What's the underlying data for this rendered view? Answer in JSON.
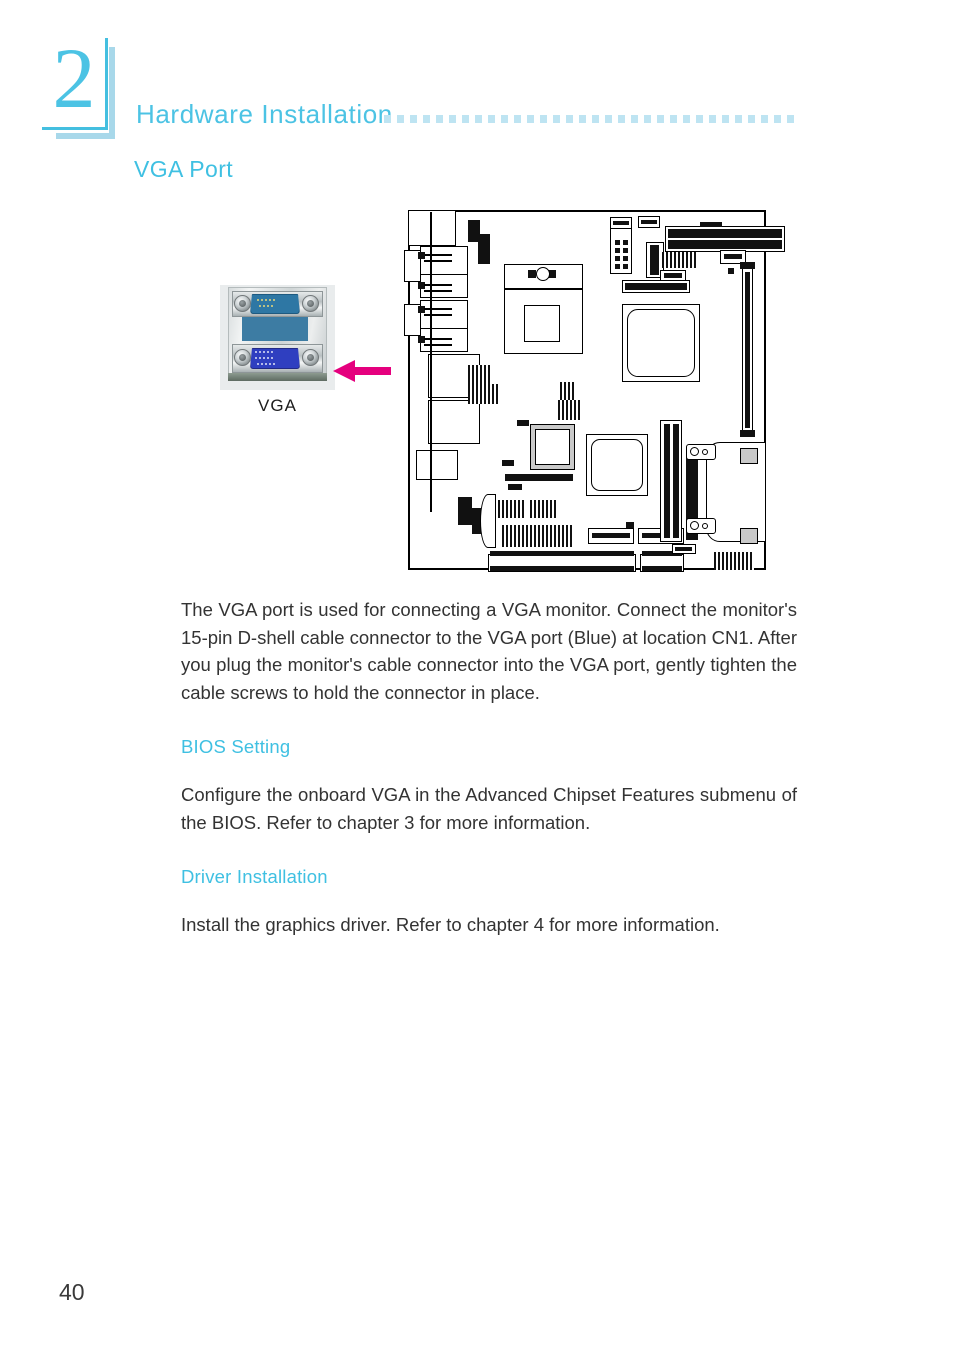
{
  "page": {
    "number": "40",
    "chapter_number": "2",
    "chapter_title": "Hardware Installation",
    "accent_color": "#3fc0e2",
    "accent_light_color": "#bee4f2",
    "arrow_color": "#e5007e",
    "body_color": "#333333"
  },
  "section": {
    "heading": "VGA Port"
  },
  "figure": {
    "photo_caption": "VGA",
    "arrow_icon": "left-arrow-icon",
    "photo_alt": "VGA port connector photo",
    "board_alt": "motherboard layout diagram"
  },
  "paragraphs": {
    "intro": "The VGA port is used for connecting a VGA monitor. Connect the monitor's 15-pin D-shell cable connector to the VGA port (Blue) at location CN1. After you plug the monitor's cable connector into the VGA port, gently tighten the cable screws to hold the connector in place."
  },
  "subsections": [
    {
      "heading": "BIOS Setting",
      "body": "Configure the onboard VGA in the Advanced Chipset Features submenu of the BIOS. Refer to chapter 3 for more information."
    },
    {
      "heading": "Driver Installation",
      "body": "Install the graphics driver. Refer to chapter 4 for more information."
    }
  ]
}
